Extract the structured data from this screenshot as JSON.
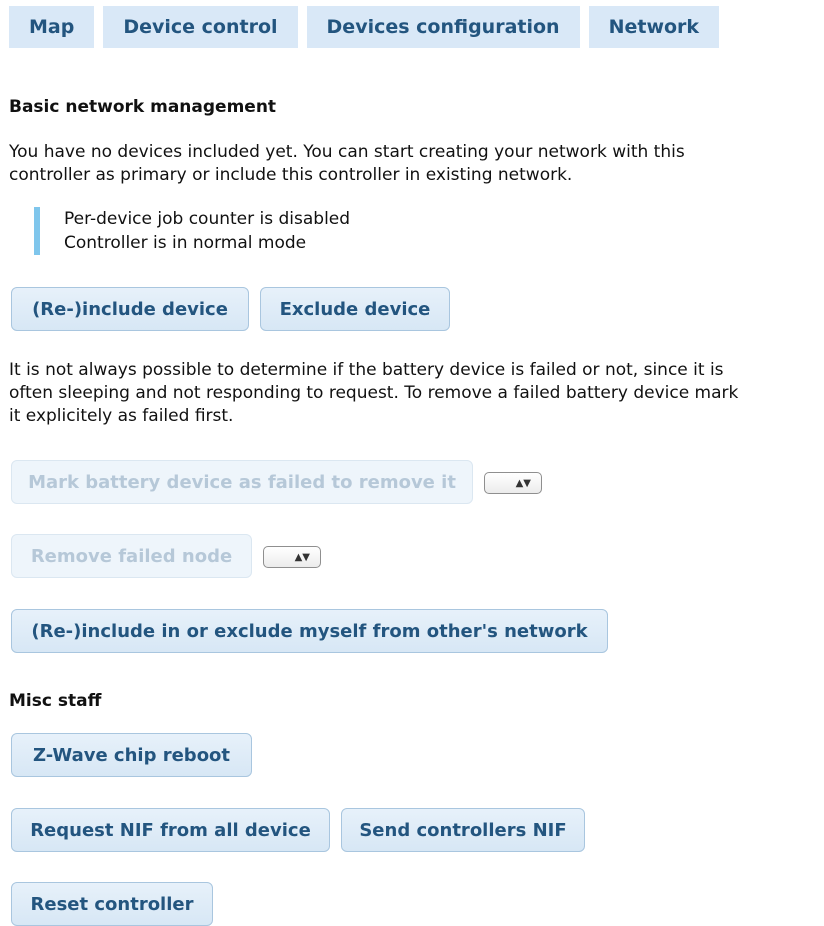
{
  "tabs": [
    "Map",
    "Device control",
    "Devices configuration",
    "Network"
  ],
  "basic": {
    "heading": "Basic network management",
    "intro_line1": "You have no devices included yet. You can start creating your network with this",
    "intro_line2": "controller as primary or include this controller in existing network.",
    "status_line1": "Per-device job counter is disabled",
    "status_line2": "Controller is in normal mode",
    "include_button": "(Re-)include device",
    "exclude_button": "Exclude device",
    "battery_line1": "It is not always possible to determine if the battery device is failed or not, since it is",
    "battery_line2": "often sleeping and not responding to request. To remove a failed battery device mark",
    "battery_line3": "it explicitely as failed first.",
    "mark_failed_button": "Mark battery device as failed to remove it",
    "remove_failed_button": "Remove failed node",
    "include_myself_button": "(Re-)include in or exclude myself from other's network"
  },
  "misc": {
    "heading": "Misc staff",
    "reboot_button": "Z-Wave chip reboot",
    "request_nif_button": "Request NIF from all device",
    "send_nif_button": "Send controllers NIF",
    "reset_button": "Reset controller"
  },
  "icons": {
    "stepper": "stepper-arrows-icon"
  },
  "colors": {
    "tab_bg": "#d9e8f7",
    "button_text": "#23557f",
    "note_bar": "#7fc6ec"
  }
}
